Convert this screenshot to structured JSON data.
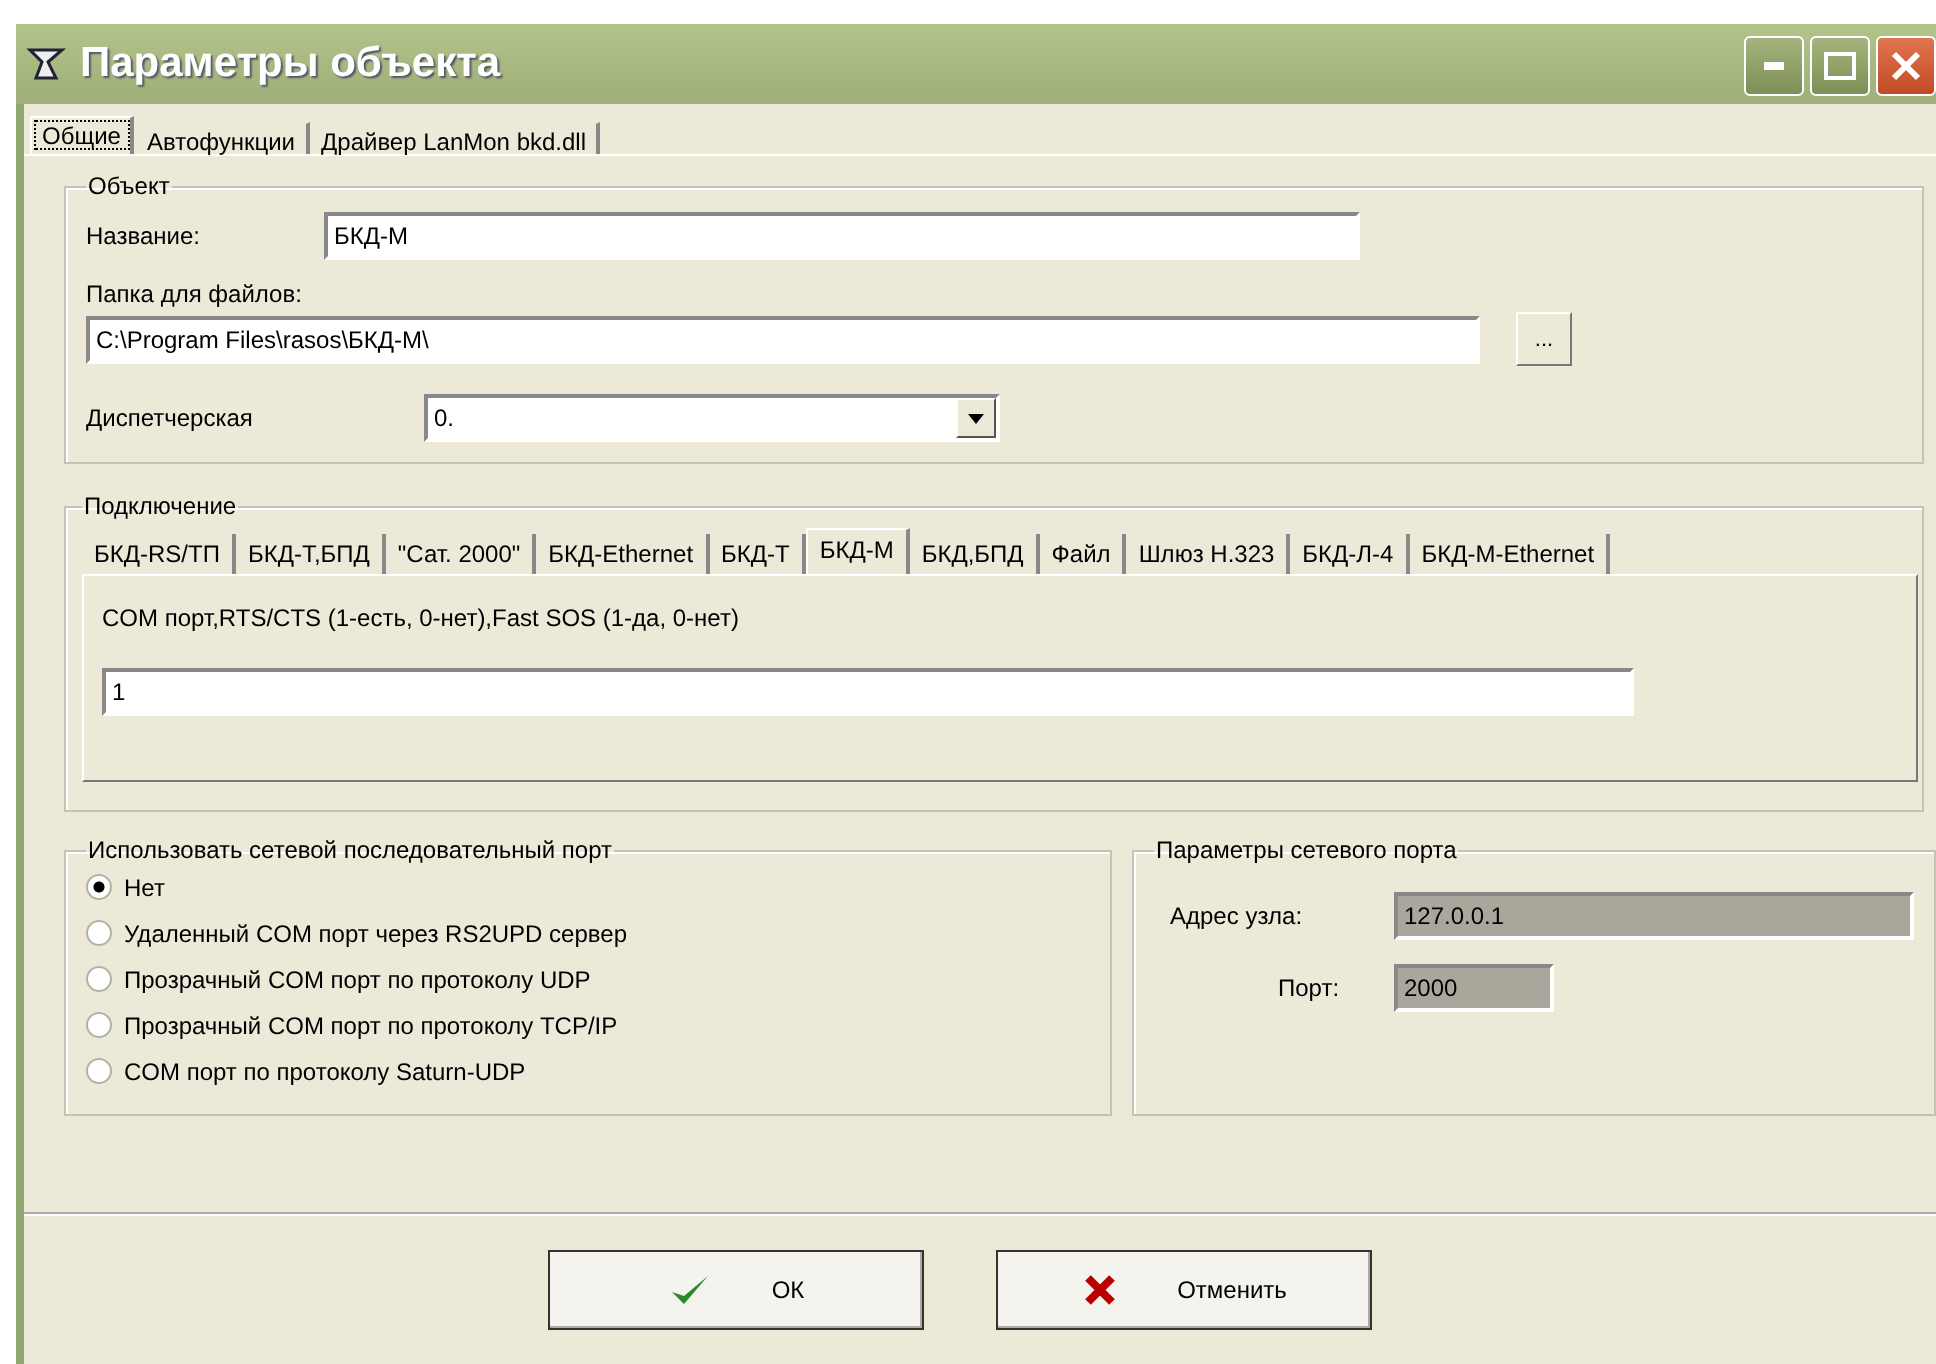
{
  "window": {
    "title": "Параметры объекта"
  },
  "tabs": [
    {
      "label": "Общие",
      "selected": true
    },
    {
      "label": "Автофункции",
      "selected": false
    },
    {
      "label": "Драйвер LanMon bkd.dll",
      "selected": false
    }
  ],
  "object_group": {
    "title": "Объект",
    "name_label": "Название:",
    "name_value": "БКД-М",
    "folder_label": "Папка для файлов:",
    "folder_value": "C:\\Program Files\\rasos\\БКД-М\\",
    "browse_button": "...",
    "dispatch_label": "Диспетчерская",
    "dispatch_value": "0."
  },
  "connection_group": {
    "title": "Подключение",
    "tabs": [
      {
        "label": "БКД-RS/ТП",
        "selected": false
      },
      {
        "label": "БКД-Т,БПД",
        "selected": false
      },
      {
        "label": "\"Сат. 2000\"",
        "selected": false
      },
      {
        "label": "БКД-Ethernet",
        "selected": false
      },
      {
        "label": "БКД-Т",
        "selected": false
      },
      {
        "label": "БКД-М",
        "selected": true
      },
      {
        "label": "БКД,БПД",
        "selected": false
      },
      {
        "label": "Файл",
        "selected": false
      },
      {
        "label": "Шлюз H.323",
        "selected": false
      },
      {
        "label": "БКД-Л-4",
        "selected": false
      },
      {
        "label": "БКД-М-Ethernet",
        "selected": false
      }
    ],
    "description": "COM порт,RTS/CTS (1-есть, 0-нет),Fast SOS (1-да, 0-нет)",
    "value": "1"
  },
  "serial_group": {
    "title": "Использовать сетевой последовательный порт",
    "options": [
      {
        "label": "Нет",
        "selected": true
      },
      {
        "label": "Удаленный COM порт через RS2UPD сервер",
        "selected": false
      },
      {
        "label": "Прозрачный COM порт по протоколу UDP",
        "selected": false
      },
      {
        "label": "Прозрачный COM порт по протоколу TCP/IP",
        "selected": false
      },
      {
        "label": "COM порт по протоколу Saturn-UDP",
        "selected": false
      }
    ]
  },
  "network_group": {
    "title": "Параметры сетевого порта",
    "address_label": "Адрес узла:",
    "address_value": "127.0.0.1",
    "port_label": "Порт:",
    "port_value": "2000"
  },
  "buttons": [
    {
      "label": "ОК",
      "kind": "ok"
    },
    {
      "label": "Отменить",
      "kind": "cancel"
    }
  ]
}
